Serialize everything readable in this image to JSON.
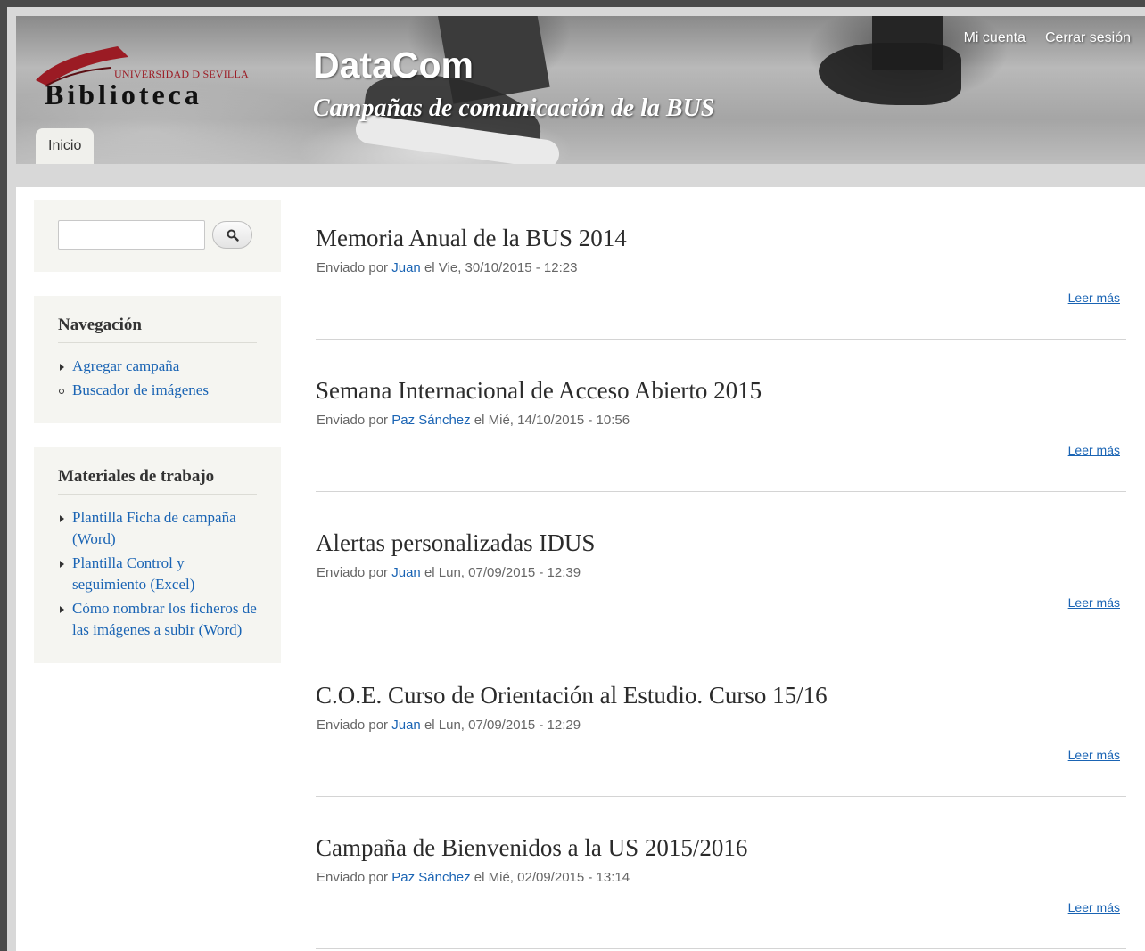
{
  "header": {
    "logo_university": "UNIVERSIDAD D SEVILLA",
    "logo_library": "Biblioteca",
    "site_name": "DataCom",
    "site_slogan": "Campañas de comunicación de la BUS",
    "secondary_menu": [
      "Mi cuenta",
      "Cerrar sesión"
    ],
    "main_tab": "Inicio"
  },
  "sidebar": {
    "search": {
      "value": "",
      "button_icon": "search-icon"
    },
    "navigation": {
      "title": "Navegación",
      "items": [
        {
          "label": "Agregar campaña",
          "bullet": "triangle"
        },
        {
          "label": "Buscador de imágenes",
          "bullet": "circle"
        }
      ]
    },
    "materials": {
      "title": "Materiales de trabajo",
      "items": [
        {
          "label": "Plantilla Ficha de campaña (Word)"
        },
        {
          "label": "Plantilla Control y seguimiento (Excel)"
        },
        {
          "label": "Cómo nombrar los ficheros de las imágenes a subir (Word)"
        }
      ]
    }
  },
  "nodes": [
    {
      "title": "Memoria Anual de la BUS 2014",
      "meta_prefix": "Enviado por",
      "author": "Juan",
      "date": "el Vie, 30/10/2015 - 12:23",
      "read_more": "Leer más"
    },
    {
      "title": "Semana Internacional de Acceso Abierto 2015",
      "meta_prefix": "Enviado por",
      "author": "Paz Sánchez",
      "date": "el Mié, 14/10/2015 - 10:56",
      "read_more": "Leer más"
    },
    {
      "title": "Alertas personalizadas IDUS",
      "meta_prefix": "Enviado por",
      "author": "Juan",
      "date": "el Lun, 07/09/2015 - 12:39",
      "read_more": "Leer más"
    },
    {
      "title": "C.O.E. Curso de Orientación al Estudio. Curso 15/16",
      "meta_prefix": "Enviado por",
      "author": "Juan",
      "date": "el Lun, 07/09/2015 - 12:29",
      "read_more": "Leer más"
    },
    {
      "title": "Campaña de Bienvenidos a la US 2015/2016",
      "meta_prefix": "Enviado por",
      "author": "Paz Sánchez",
      "date": "el Mié, 02/09/2015 - 13:14",
      "read_more": "Leer más"
    }
  ],
  "colors": {
    "link": "#1a64b4",
    "brand_red": "#9b1b24"
  }
}
